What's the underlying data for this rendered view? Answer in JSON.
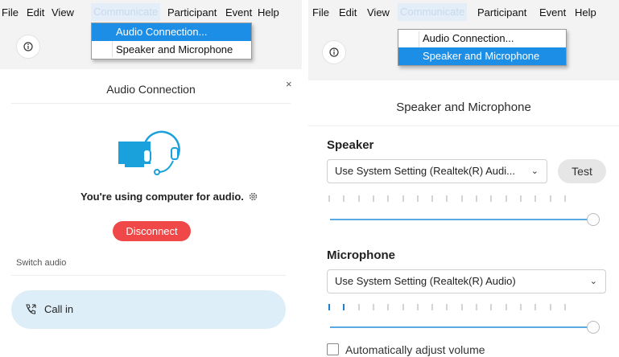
{
  "menu": {
    "items": [
      "File",
      "Edit",
      "View",
      "Communicate",
      "Participant",
      "Event",
      "Help"
    ],
    "active_item": "Communicate",
    "dropdown": [
      "Audio Connection...",
      "Speaker and Microphone"
    ]
  },
  "left": {
    "highlighted_menu_item": "Audio Connection...",
    "panel_title": "Audio Connection",
    "close_label": "×",
    "status_text": "You're using computer for audio.",
    "disconnect_label": "Disconnect",
    "switch_audio_label": "Switch audio",
    "call_in_label": "Call in"
  },
  "right": {
    "highlighted_menu_item": "Speaker and Microphone",
    "panel_title": "Speaker and Microphone",
    "speaker": {
      "heading": "Speaker",
      "selected": "Use System Setting (Realtek(R) Audi...",
      "test_label": "Test",
      "meter_active_ticks": 0,
      "volume": 1.0
    },
    "microphone": {
      "heading": "Microphone",
      "selected": "Use System Setting (Realtek(R) Audio)",
      "meter_active_ticks": 2,
      "volume": 1.0
    },
    "auto_adjust_label": "Automatically adjust volume",
    "auto_adjust_checked": false
  },
  "colors": {
    "accent": "#1d8ee6",
    "disconnect": "#f04848",
    "callin_bg": "#ddeef9",
    "illustration": "#1aa1dc"
  },
  "icons": [
    "info-icon",
    "close-icon",
    "computer-headset-icon",
    "gear-icon",
    "phone-callin-icon",
    "chevron-down-icon"
  ]
}
